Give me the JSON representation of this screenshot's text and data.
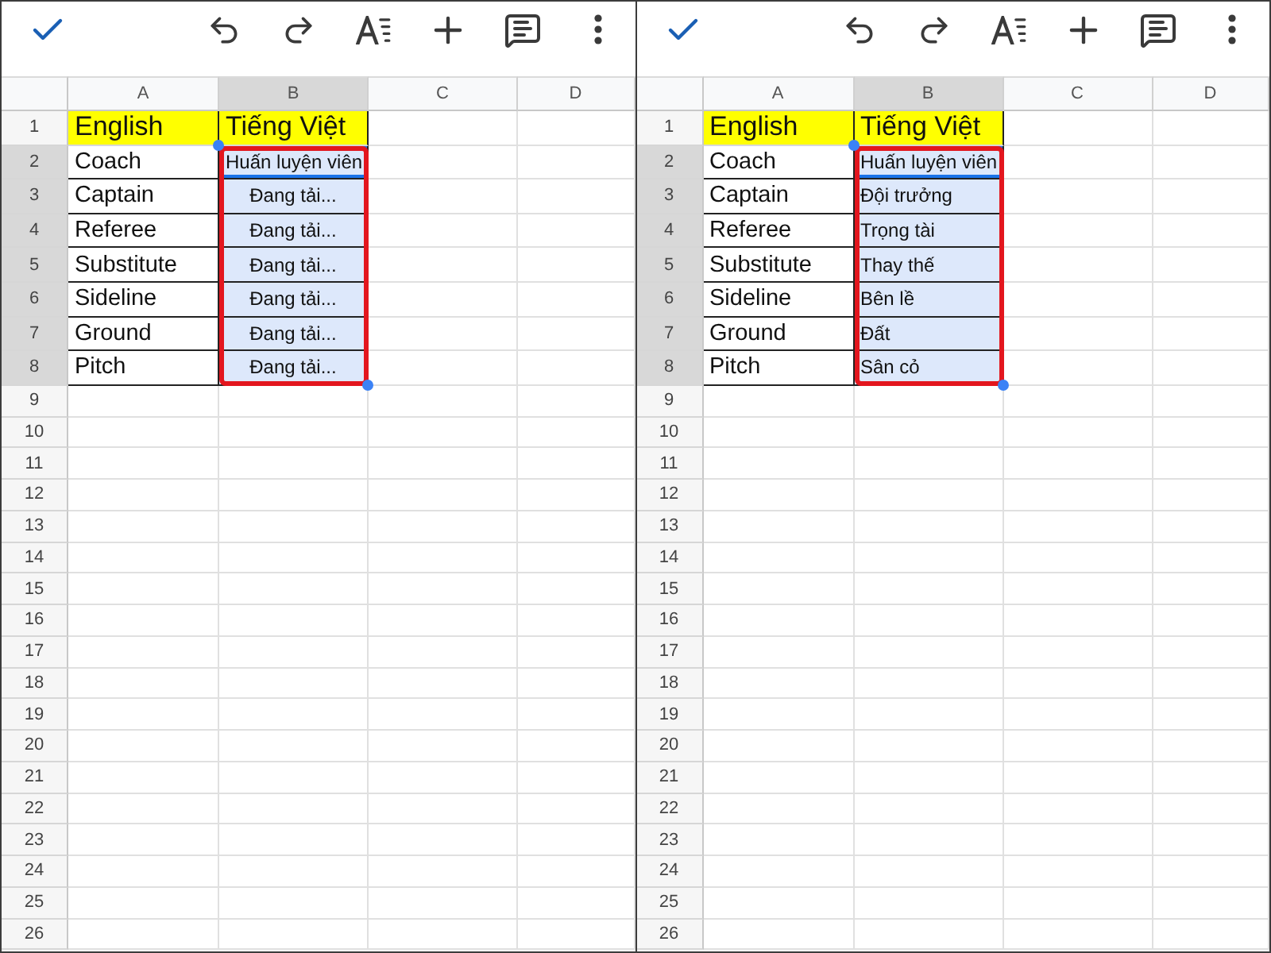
{
  "panels": [
    {
      "highlight_frame": true,
      "columns": [
        {
          "label": "A",
          "selected": false
        },
        {
          "label": "B",
          "selected": true
        },
        {
          "label": "C",
          "selected": false
        },
        {
          "label": "D",
          "selected": false
        }
      ],
      "rows": [
        {
          "label": "1",
          "selected": false,
          "cells": [
            {
              "kind": "title",
              "text": "English",
              "selected": false,
              "active": false
            },
            {
              "kind": "title",
              "text": "Tiếng Việt",
              "selected": false,
              "active": false
            }
          ]
        },
        {
          "label": "2",
          "selected": true,
          "cells": [
            {
              "kind": "text",
              "text": "Coach",
              "selected": false,
              "active": false
            },
            {
              "kind": "text",
              "text": "Huấn luyện viên",
              "selected": true,
              "active": true
            }
          ]
        },
        {
          "label": "3",
          "selected": true,
          "cells": [
            {
              "kind": "text",
              "text": "Captain",
              "selected": false,
              "active": false
            },
            {
              "kind": "loading",
              "text": "Đang tải...",
              "selected": true,
              "active": false
            }
          ]
        },
        {
          "label": "4",
          "selected": true,
          "cells": [
            {
              "kind": "text",
              "text": "Referee",
              "selected": false,
              "active": false
            },
            {
              "kind": "loading",
              "text": "Đang tải...",
              "selected": true,
              "active": false
            }
          ]
        },
        {
          "label": "5",
          "selected": true,
          "cells": [
            {
              "kind": "text",
              "text": "Substitute",
              "selected": false,
              "active": false
            },
            {
              "kind": "loading",
              "text": "Đang tải...",
              "selected": true,
              "active": false
            }
          ]
        },
        {
          "label": "6",
          "selected": true,
          "cells": [
            {
              "kind": "text",
              "text": "Sideline",
              "selected": false,
              "active": false
            },
            {
              "kind": "loading",
              "text": "Đang tải...",
              "selected": true,
              "active": false
            }
          ]
        },
        {
          "label": "7",
          "selected": true,
          "cells": [
            {
              "kind": "text",
              "text": "Ground",
              "selected": false,
              "active": false
            },
            {
              "kind": "loading",
              "text": "Đang tải...",
              "selected": true,
              "active": false
            }
          ]
        },
        {
          "label": "8",
          "selected": true,
          "cells": [
            {
              "kind": "text",
              "text": "Pitch",
              "selected": false,
              "active": false
            },
            {
              "kind": "loading",
              "text": "Đang tải...",
              "selected": true,
              "active": false
            }
          ]
        },
        {
          "label": "9",
          "selected": false
        },
        {
          "label": "10",
          "selected": false
        },
        {
          "label": "11",
          "selected": false
        },
        {
          "label": "12",
          "selected": false
        },
        {
          "label": "13",
          "selected": false
        },
        {
          "label": "14",
          "selected": false
        },
        {
          "label": "15",
          "selected": false
        },
        {
          "label": "16",
          "selected": false
        },
        {
          "label": "17",
          "selected": false
        },
        {
          "label": "18",
          "selected": false
        },
        {
          "label": "19",
          "selected": false
        },
        {
          "label": "20",
          "selected": false
        },
        {
          "label": "21",
          "selected": false
        },
        {
          "label": "22",
          "selected": false
        },
        {
          "label": "23",
          "selected": false
        },
        {
          "label": "24",
          "selected": false
        },
        {
          "label": "25",
          "selected": false
        },
        {
          "label": "26",
          "selected": false
        }
      ]
    },
    {
      "highlight_frame": true,
      "columns": [
        {
          "label": "A",
          "selected": false
        },
        {
          "label": "B",
          "selected": true
        },
        {
          "label": "C",
          "selected": false
        },
        {
          "label": "D",
          "selected": false
        }
      ],
      "rows": [
        {
          "label": "1",
          "selected": false,
          "cells": [
            {
              "kind": "title",
              "text": "English",
              "selected": false,
              "active": false
            },
            {
              "kind": "title",
              "text": "Tiếng Việt",
              "selected": false,
              "active": false
            }
          ]
        },
        {
          "label": "2",
          "selected": true,
          "cells": [
            {
              "kind": "text",
              "text": "Coach",
              "selected": false,
              "active": false
            },
            {
              "kind": "text",
              "text": "Huấn luyện viên",
              "selected": true,
              "active": true
            }
          ]
        },
        {
          "label": "3",
          "selected": true,
          "cells": [
            {
              "kind": "text",
              "text": "Captain",
              "selected": false,
              "active": false
            },
            {
              "kind": "text",
              "text": "Đội trưởng",
              "selected": true,
              "active": false
            }
          ]
        },
        {
          "label": "4",
          "selected": true,
          "cells": [
            {
              "kind": "text",
              "text": "Referee",
              "selected": false,
              "active": false
            },
            {
              "kind": "text",
              "text": "Trọng tài",
              "selected": true,
              "active": false
            }
          ]
        },
        {
          "label": "5",
          "selected": true,
          "cells": [
            {
              "kind": "text",
              "text": "Substitute",
              "selected": false,
              "active": false
            },
            {
              "kind": "text",
              "text": "Thay thế",
              "selected": true,
              "active": false
            }
          ]
        },
        {
          "label": "6",
          "selected": true,
          "cells": [
            {
              "kind": "text",
              "text": "Sideline",
              "selected": false,
              "active": false
            },
            {
              "kind": "text",
              "text": "Bên lề",
              "selected": true,
              "active": false
            }
          ]
        },
        {
          "label": "7",
          "selected": true,
          "cells": [
            {
              "kind": "text",
              "text": "Ground",
              "selected": false,
              "active": false
            },
            {
              "kind": "text",
              "text": "Đất",
              "selected": true,
              "active": false
            }
          ]
        },
        {
          "label": "8",
          "selected": true,
          "cells": [
            {
              "kind": "text",
              "text": "Pitch",
              "selected": false,
              "active": false
            },
            {
              "kind": "text",
              "text": "Sân cỏ",
              "selected": true,
              "active": false
            }
          ]
        },
        {
          "label": "9",
          "selected": false
        },
        {
          "label": "10",
          "selected": false
        },
        {
          "label": "11",
          "selected": false
        },
        {
          "label": "12",
          "selected": false
        },
        {
          "label": "13",
          "selected": false
        },
        {
          "label": "14",
          "selected": false
        },
        {
          "label": "15",
          "selected": false
        },
        {
          "label": "16",
          "selected": false
        },
        {
          "label": "17",
          "selected": false
        },
        {
          "label": "18",
          "selected": false
        },
        {
          "label": "19",
          "selected": false
        },
        {
          "label": "20",
          "selected": false
        },
        {
          "label": "21",
          "selected": false
        },
        {
          "label": "22",
          "selected": false
        },
        {
          "label": "23",
          "selected": false
        },
        {
          "label": "24",
          "selected": false
        },
        {
          "label": "25",
          "selected": false
        },
        {
          "label": "26",
          "selected": false
        }
      ]
    }
  ]
}
